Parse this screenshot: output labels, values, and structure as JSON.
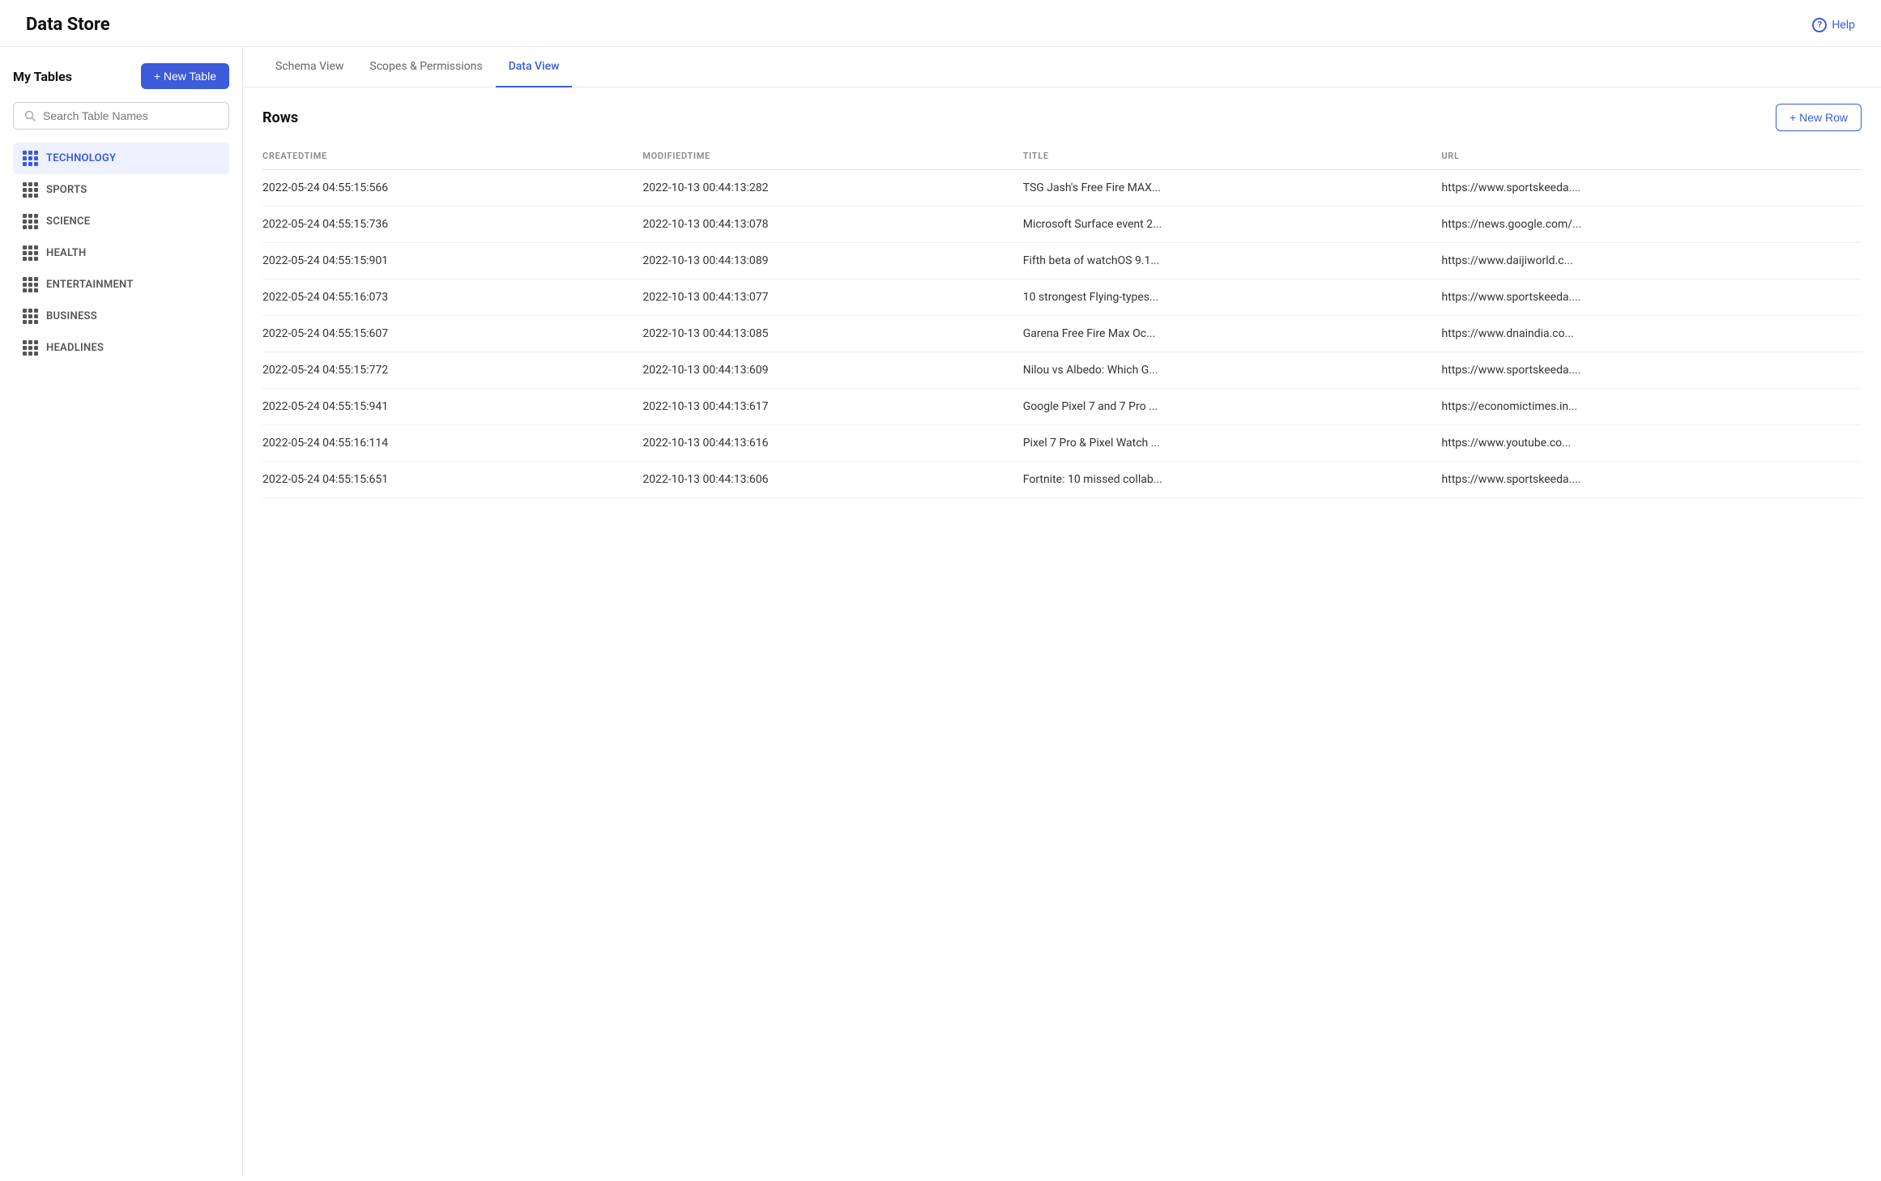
{
  "header": {
    "title": "Data Store",
    "help_label": "Help"
  },
  "sidebar": {
    "title": "My Tables",
    "new_table_btn": "+ New Table",
    "search_placeholder": "Search Table Names",
    "tables": [
      {
        "name": "TECHNOLOGY",
        "active": true
      },
      {
        "name": "SPORTS",
        "active": false
      },
      {
        "name": "SCIENCE",
        "active": false
      },
      {
        "name": "HEALTH",
        "active": false
      },
      {
        "name": "ENTERTAINMENT",
        "active": false
      },
      {
        "name": "BUSINESS",
        "active": false
      },
      {
        "name": "HEADLINES",
        "active": false
      }
    ]
  },
  "tabs": [
    {
      "label": "Schema View",
      "active": false
    },
    {
      "label": "Scopes & Permissions",
      "active": false
    },
    {
      "label": "Data View",
      "active": true
    }
  ],
  "rows_section": {
    "title": "Rows",
    "new_row_btn": "+ New Row",
    "columns": [
      "CREATEDTIME",
      "MODIFIEDTIME",
      "title",
      "url"
    ],
    "rows": [
      {
        "createdtime": "2022-05-24 04:55:15:566",
        "modifiedtime": "2022-10-13 00:44:13:282",
        "title": "TSG Jash's Free Fire MAX...",
        "url": "https://www.sportskeeda...."
      },
      {
        "createdtime": "2022-05-24 04:55:15:736",
        "modifiedtime": "2022-10-13 00:44:13:078",
        "title": "Microsoft Surface event 2...",
        "url": "https://news.google.com/..."
      },
      {
        "createdtime": "2022-05-24 04:55:15:901",
        "modifiedtime": "2022-10-13 00:44:13:089",
        "title": "Fifth beta of watchOS 9.1...",
        "url": "https://www.daijiworld.c..."
      },
      {
        "createdtime": "2022-05-24 04:55:16:073",
        "modifiedtime": "2022-10-13 00:44:13:077",
        "title": "10 strongest Flying-types...",
        "url": "https://www.sportskeeda...."
      },
      {
        "createdtime": "2022-05-24 04:55:15:607",
        "modifiedtime": "2022-10-13 00:44:13:085",
        "title": "Garena Free Fire Max Oc...",
        "url": "https://www.dnaindia.co..."
      },
      {
        "createdtime": "2022-05-24 04:55:15:772",
        "modifiedtime": "2022-10-13 00:44:13:609",
        "title": "Nilou vs Albedo: Which G...",
        "url": "https://www.sportskeeda...."
      },
      {
        "createdtime": "2022-05-24 04:55:15:941",
        "modifiedtime": "2022-10-13 00:44:13:617",
        "title": "Google Pixel 7 and 7 Pro ...",
        "url": "https://economictimes.in..."
      },
      {
        "createdtime": "2022-05-24 04:55:16:114",
        "modifiedtime": "2022-10-13 00:44:13:616",
        "title": "Pixel 7 Pro & Pixel Watch ...",
        "url": "https://www.youtube.co..."
      },
      {
        "createdtime": "2022-05-24 04:55:15:651",
        "modifiedtime": "2022-10-13 00:44:13:606",
        "title": "Fortnite: 10 missed collab...",
        "url": "https://www.sportskeeda...."
      }
    ]
  },
  "colors": {
    "accent": "#3b5bdb",
    "active_bg": "#eef1ff",
    "border": "#e8e8e8"
  }
}
